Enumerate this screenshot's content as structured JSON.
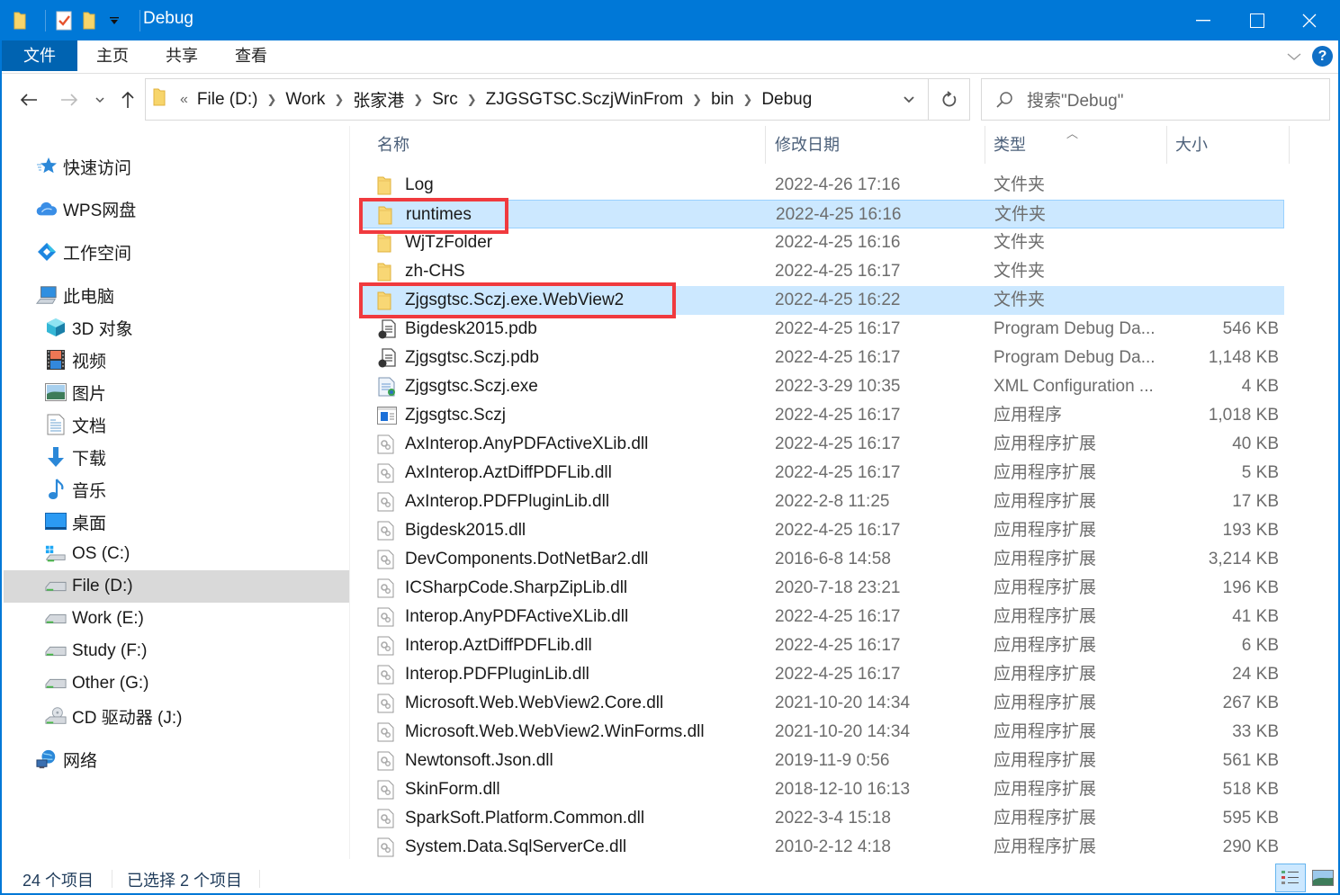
{
  "window": {
    "title": "Debug"
  },
  "ribbon": {
    "tabs": [
      {
        "label": "文件",
        "active": true
      },
      {
        "label": "主页"
      },
      {
        "label": "共享"
      },
      {
        "label": "查看"
      }
    ],
    "help_label": "?"
  },
  "nav": {
    "breadcrumb_overflow": "«",
    "breadcrumbs": [
      "File (D:)",
      "Work",
      "张家港",
      "Src",
      "ZJGSGTSC.SczjWinFrom",
      "bin",
      "Debug"
    ],
    "search_placeholder": "搜索\"Debug\""
  },
  "sidebar": {
    "items": [
      {
        "label": "快速访问",
        "icon": "quick-access-star-icon"
      },
      {
        "label": "WPS网盘",
        "icon": "wps-cloud-icon"
      },
      {
        "label": "工作空间",
        "icon": "workspace-icon"
      },
      {
        "label": "此电脑",
        "icon": "this-pc-icon"
      },
      {
        "label": "3D 对象",
        "icon": "3d-objects-icon"
      },
      {
        "label": "视频",
        "icon": "videos-icon"
      },
      {
        "label": "图片",
        "icon": "pictures-icon"
      },
      {
        "label": "文档",
        "icon": "documents-icon"
      },
      {
        "label": "下载",
        "icon": "downloads-icon"
      },
      {
        "label": "音乐",
        "icon": "music-icon"
      },
      {
        "label": "桌面",
        "icon": "desktop-icon"
      },
      {
        "label": "OS (C:)",
        "icon": "os-drive-icon"
      },
      {
        "label": "File (D:)",
        "icon": "drive-icon",
        "selected": true
      },
      {
        "label": "Work (E:)",
        "icon": "drive-icon"
      },
      {
        "label": "Study (F:)",
        "icon": "drive-icon"
      },
      {
        "label": "Other (G:)",
        "icon": "drive-icon"
      },
      {
        "label": "CD 驱动器 (J:)",
        "icon": "cd-drive-icon"
      },
      {
        "label": "网络",
        "icon": "network-icon"
      }
    ]
  },
  "columns": {
    "name": "名称",
    "date": "修改日期",
    "type": "类型",
    "size": "大小"
  },
  "files": [
    {
      "name": "Log",
      "date": "2022-4-26 17:16",
      "type": "文件夹",
      "size": "",
      "kind": "folder"
    },
    {
      "name": "runtimes",
      "date": "2022-4-25 16:16",
      "type": "文件夹",
      "size": "",
      "kind": "folder",
      "selected": true,
      "focused": true
    },
    {
      "name": "WjTzFolder",
      "date": "2022-4-25 16:16",
      "type": "文件夹",
      "size": "",
      "kind": "folder"
    },
    {
      "name": "zh-CHS",
      "date": "2022-4-25 16:17",
      "type": "文件夹",
      "size": "",
      "kind": "folder"
    },
    {
      "name": "Zjgsgtsc.Sczj.exe.WebView2",
      "date": "2022-4-25 16:22",
      "type": "文件夹",
      "size": "",
      "kind": "folder",
      "selected": true
    },
    {
      "name": "Bigdesk2015.pdb",
      "date": "2022-4-25 16:17",
      "type": "Program Debug Da...",
      "size": "546 KB",
      "kind": "pdb"
    },
    {
      "name": "Zjgsgtsc.Sczj.pdb",
      "date": "2022-4-25 16:17",
      "type": "Program Debug Da...",
      "size": "1,148 KB",
      "kind": "pdb"
    },
    {
      "name": "Zjgsgtsc.Sczj.exe",
      "date": "2022-3-29 10:35",
      "type": "XML Configuration ...",
      "size": "4 KB",
      "kind": "config"
    },
    {
      "name": "Zjgsgtsc.Sczj",
      "date": "2022-4-25 16:17",
      "type": "应用程序",
      "size": "1,018 KB",
      "kind": "exe"
    },
    {
      "name": "AxInterop.AnyPDFActiveXLib.dll",
      "date": "2022-4-25 16:17",
      "type": "应用程序扩展",
      "size": "40 KB",
      "kind": "dll"
    },
    {
      "name": "AxInterop.AztDiffPDFLib.dll",
      "date": "2022-4-25 16:17",
      "type": "应用程序扩展",
      "size": "5 KB",
      "kind": "dll"
    },
    {
      "name": "AxInterop.PDFPluginLib.dll",
      "date": "2022-2-8 11:25",
      "type": "应用程序扩展",
      "size": "17 KB",
      "kind": "dll"
    },
    {
      "name": "Bigdesk2015.dll",
      "date": "2022-4-25 16:17",
      "type": "应用程序扩展",
      "size": "193 KB",
      "kind": "dll"
    },
    {
      "name": "DevComponents.DotNetBar2.dll",
      "date": "2016-6-8 14:58",
      "type": "应用程序扩展",
      "size": "3,214 KB",
      "kind": "dll"
    },
    {
      "name": "ICSharpCode.SharpZipLib.dll",
      "date": "2020-7-18 23:21",
      "type": "应用程序扩展",
      "size": "196 KB",
      "kind": "dll"
    },
    {
      "name": "Interop.AnyPDFActiveXLib.dll",
      "date": "2022-4-25 16:17",
      "type": "应用程序扩展",
      "size": "41 KB",
      "kind": "dll"
    },
    {
      "name": "Interop.AztDiffPDFLib.dll",
      "date": "2022-4-25 16:17",
      "type": "应用程序扩展",
      "size": "6 KB",
      "kind": "dll"
    },
    {
      "name": "Interop.PDFPluginLib.dll",
      "date": "2022-4-25 16:17",
      "type": "应用程序扩展",
      "size": "24 KB",
      "kind": "dll"
    },
    {
      "name": "Microsoft.Web.WebView2.Core.dll",
      "date": "2021-10-20 14:34",
      "type": "应用程序扩展",
      "size": "267 KB",
      "kind": "dll"
    },
    {
      "name": "Microsoft.Web.WebView2.WinForms.dll",
      "date": "2021-10-20 14:34",
      "type": "应用程序扩展",
      "size": "33 KB",
      "kind": "dll"
    },
    {
      "name": "Newtonsoft.Json.dll",
      "date": "2019-11-9 0:56",
      "type": "应用程序扩展",
      "size": "561 KB",
      "kind": "dll"
    },
    {
      "name": "SkinForm.dll",
      "date": "2018-12-10 16:13",
      "type": "应用程序扩展",
      "size": "518 KB",
      "kind": "dll"
    },
    {
      "name": "SparkSoft.Platform.Common.dll",
      "date": "2022-3-4 15:18",
      "type": "应用程序扩展",
      "size": "595 KB",
      "kind": "dll"
    },
    {
      "name": "System.Data.SqlServerCe.dll",
      "date": "2010-2-12 4:18",
      "type": "应用程序扩展",
      "size": "290 KB",
      "kind": "dll"
    }
  ],
  "status": {
    "item_count": "24 个项目",
    "selected_count": "已选择 2 个项目"
  },
  "colors": {
    "accent": "#0078d7",
    "selection": "#cce8ff",
    "annotation": "#f03a3e"
  }
}
